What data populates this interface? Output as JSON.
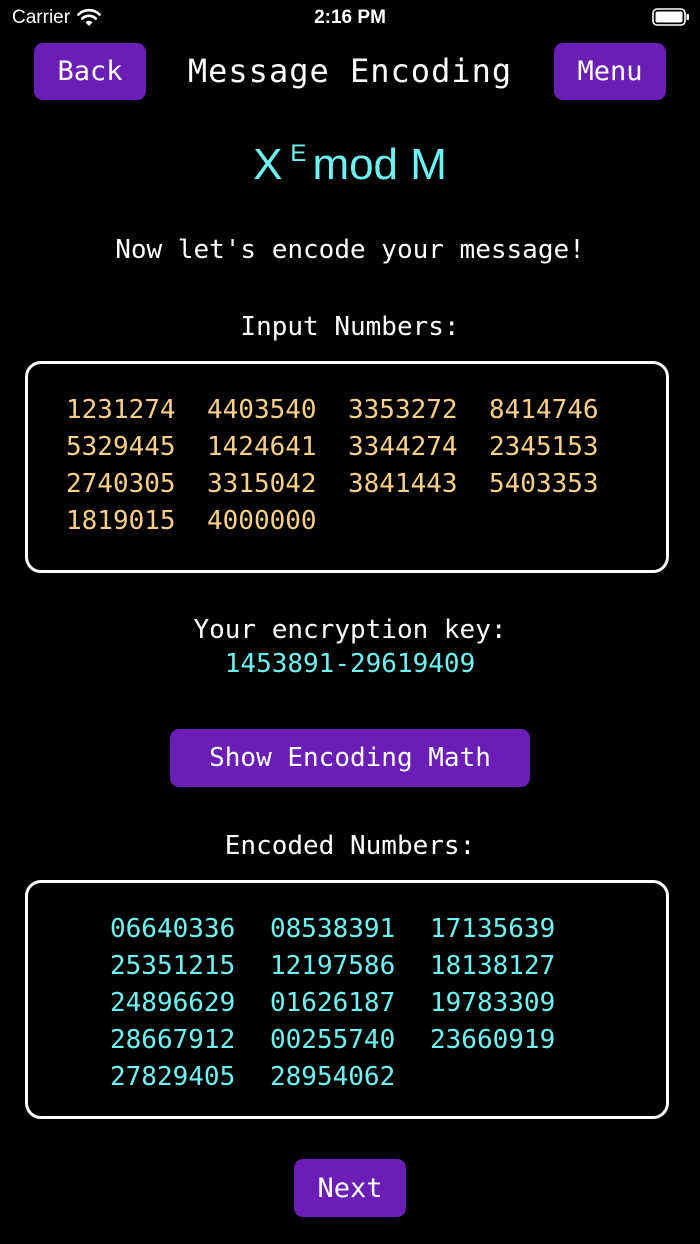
{
  "status_bar": {
    "carrier": "Carrier",
    "time": "2:16 PM"
  },
  "nav": {
    "back_label": "Back",
    "title": "Message Encoding",
    "menu_label": "Menu"
  },
  "formula": {
    "base": "X",
    "exponent": "E",
    "rest": "mod M"
  },
  "intro": "Now let's encode your message!",
  "input_section": {
    "label": "Input Numbers:",
    "numbers": [
      "1231274",
      "4403540",
      "3353272",
      "8414746",
      "5329445",
      "1424641",
      "3344274",
      "2345153",
      "2740305",
      "3315042",
      "3841443",
      "5403353",
      "1819015",
      "4000000"
    ]
  },
  "key_section": {
    "label": "Your encryption key:",
    "value": "1453891-29619409"
  },
  "show_math_label": "Show Encoding Math",
  "encoded_section": {
    "label": "Encoded Numbers:",
    "numbers": [
      "06640336",
      "08538391",
      "17135639",
      "25351215",
      "12197586",
      "18138127",
      "24896629",
      "01626187",
      "19783309",
      "28667912",
      "00255740",
      "23660919",
      "27829405",
      "28954062"
    ]
  },
  "next_label": "Next",
  "colors": {
    "button_purple": "#6a1eb6",
    "cyan": "#6ff4f4",
    "input_yellow": "#f9d08a",
    "background": "#000000"
  }
}
